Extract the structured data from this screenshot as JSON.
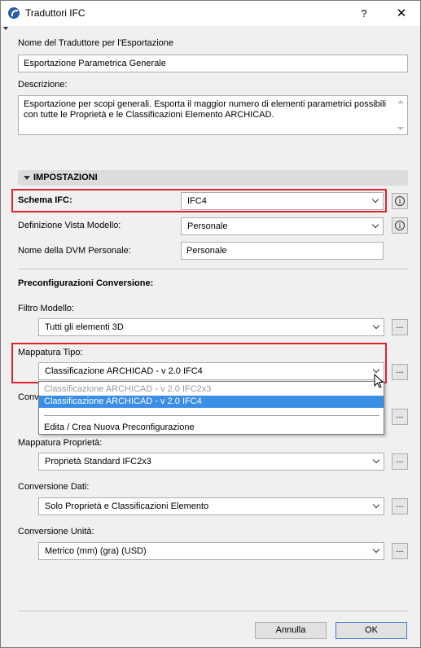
{
  "window": {
    "title": "Traduttori IFC",
    "help_label": "?",
    "close_label": "✕"
  },
  "name_section": {
    "label": "Nome del Traduttore per l'Esportazione",
    "value": "Esportazione Parametrica Generale"
  },
  "description": {
    "label": "Descrizione:",
    "value": "Esportazione per scopi generali. Esporta il maggior numero di elementi parametrici possibili con tutte le Proprietà e le Classificazioni Elemento ARCHICAD."
  },
  "settings_header": "IMPOSTAZIONI",
  "schema": {
    "label": "Schema IFC:",
    "value": "IFC4"
  },
  "mvd": {
    "label": "Definizione Vista Modello:",
    "value": "Personale"
  },
  "dvm_name": {
    "label": "Nome della DVM Personale:",
    "value": "Personale"
  },
  "presets_heading": "Preconfigurazioni Conversione:",
  "model_filter": {
    "label": "Filtro Modello:",
    "value": "Tutti gli elementi 3D"
  },
  "type_mapping": {
    "label": "Mappatura Tipo:",
    "value": "Classificazione ARCHICAD - v 2.0 IFC4",
    "options": [
      "Classificazione ARCHICAD - v 2.0 IFC2x3",
      "Classificazione ARCHICAD - v 2.0 IFC4"
    ],
    "edit_option": "Edita / Crea Nuova Preconfigurazione"
  },
  "hidden_label_fragment": "Conv",
  "property_mapping": {
    "label": "Mappatura Proprietà:",
    "value": "Proprietà Standard IFC2x3"
  },
  "data_conversion": {
    "label": "Conversione Dati:",
    "value": "Solo Proprietà e Classificazioni Elemento"
  },
  "unit_conversion": {
    "label": "Conversione Unità:",
    "value": "Metrico (mm) (gra) (USD)"
  },
  "dots_label": "...",
  "info_glyph": "i",
  "buttons": {
    "cancel": "Annulla",
    "ok": "OK"
  },
  "colors": {
    "highlight": "#e0232b",
    "selection": "#3a8ee6"
  }
}
